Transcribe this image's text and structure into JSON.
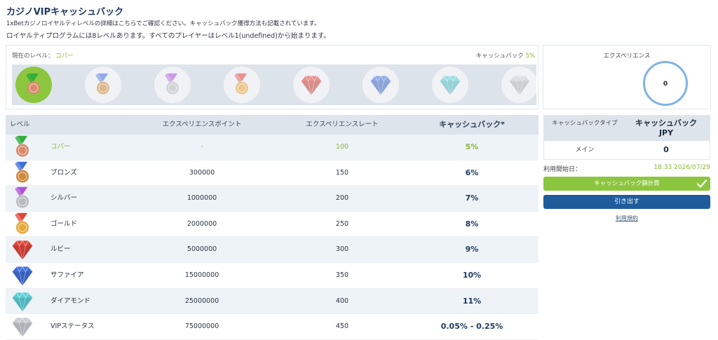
{
  "header": {
    "title": "カジノVIPキャッシュバック",
    "desc1": "1xBetカジノロイヤルティレベルの詳細はこちらでご確認ください。キャッシュバック獲得方法も記載されています。",
    "desc2": "ロイヤルティプログラムには8レベルあります。すべてのプレイヤーはレベル1(undefined)から始まります。"
  },
  "levels_panel": {
    "current_label": "現在のレベル：",
    "current_value": "コパー",
    "cashback_label": "キャッシュバック",
    "cashback_value": "5%"
  },
  "experience": {
    "title": "エクスペリエンス",
    "value": "0"
  },
  "table": {
    "headers": {
      "level": "レベル",
      "points": "エクスペリエンスポイント",
      "rate": "エクスペリエンスレート",
      "cashback": "キャッシュバック*"
    },
    "rows": [
      {
        "name": "コパー",
        "points": "-",
        "rate": "100",
        "cashback": "5%",
        "icon": "copper-medal-icon"
      },
      {
        "name": "ブロンズ",
        "points": "300000",
        "rate": "150",
        "cashback": "6%",
        "icon": "bronze-medal-icon"
      },
      {
        "name": "シルバー",
        "points": "1000000",
        "rate": "200",
        "cashback": "7%",
        "icon": "silver-medal-icon"
      },
      {
        "name": "ゴールド",
        "points": "2000000",
        "rate": "250",
        "cashback": "8%",
        "icon": "gold-medal-icon"
      },
      {
        "name": "ルビー",
        "points": "5000000",
        "rate": "300",
        "cashback": "9%",
        "icon": "ruby-gem-icon"
      },
      {
        "name": "サファイア",
        "points": "15000000",
        "rate": "350",
        "cashback": "10%",
        "icon": "sapphire-gem-icon"
      },
      {
        "name": "ダイアモンド",
        "points": "25000000",
        "rate": "400",
        "cashback": "11%",
        "icon": "diamond-gem-icon"
      },
      {
        "name": "VIPステータス",
        "points": "75000000",
        "rate": "450",
        "cashback": "0.05% - 0.25%",
        "icon": "vip-gem-icon"
      }
    ]
  },
  "sidebar": {
    "type_label": "キャッシュバックタイプ",
    "cashback_label": "キャッシュバック",
    "currency": "JPY",
    "main_label": "メイン",
    "amount": "0",
    "since_label": "利用開始日：",
    "since_value": "18:33 2026/07/29",
    "calc_button": "キャッシュバック額計算",
    "withdraw_button": "引き出す",
    "terms_link": "利用規約"
  },
  "colors": {
    "accent_green": "#8cc63f",
    "primary_blue": "#1e5c9c",
    "copper": "#d98a6a",
    "bronze": "#d08a3a",
    "silver": "#b9bcc2",
    "gold": "#e8a93a",
    "ruby": "#e0443a",
    "sapphire": "#3f6fd8",
    "diamond": "#5ccfd6",
    "vip": "#c8cbd0"
  }
}
